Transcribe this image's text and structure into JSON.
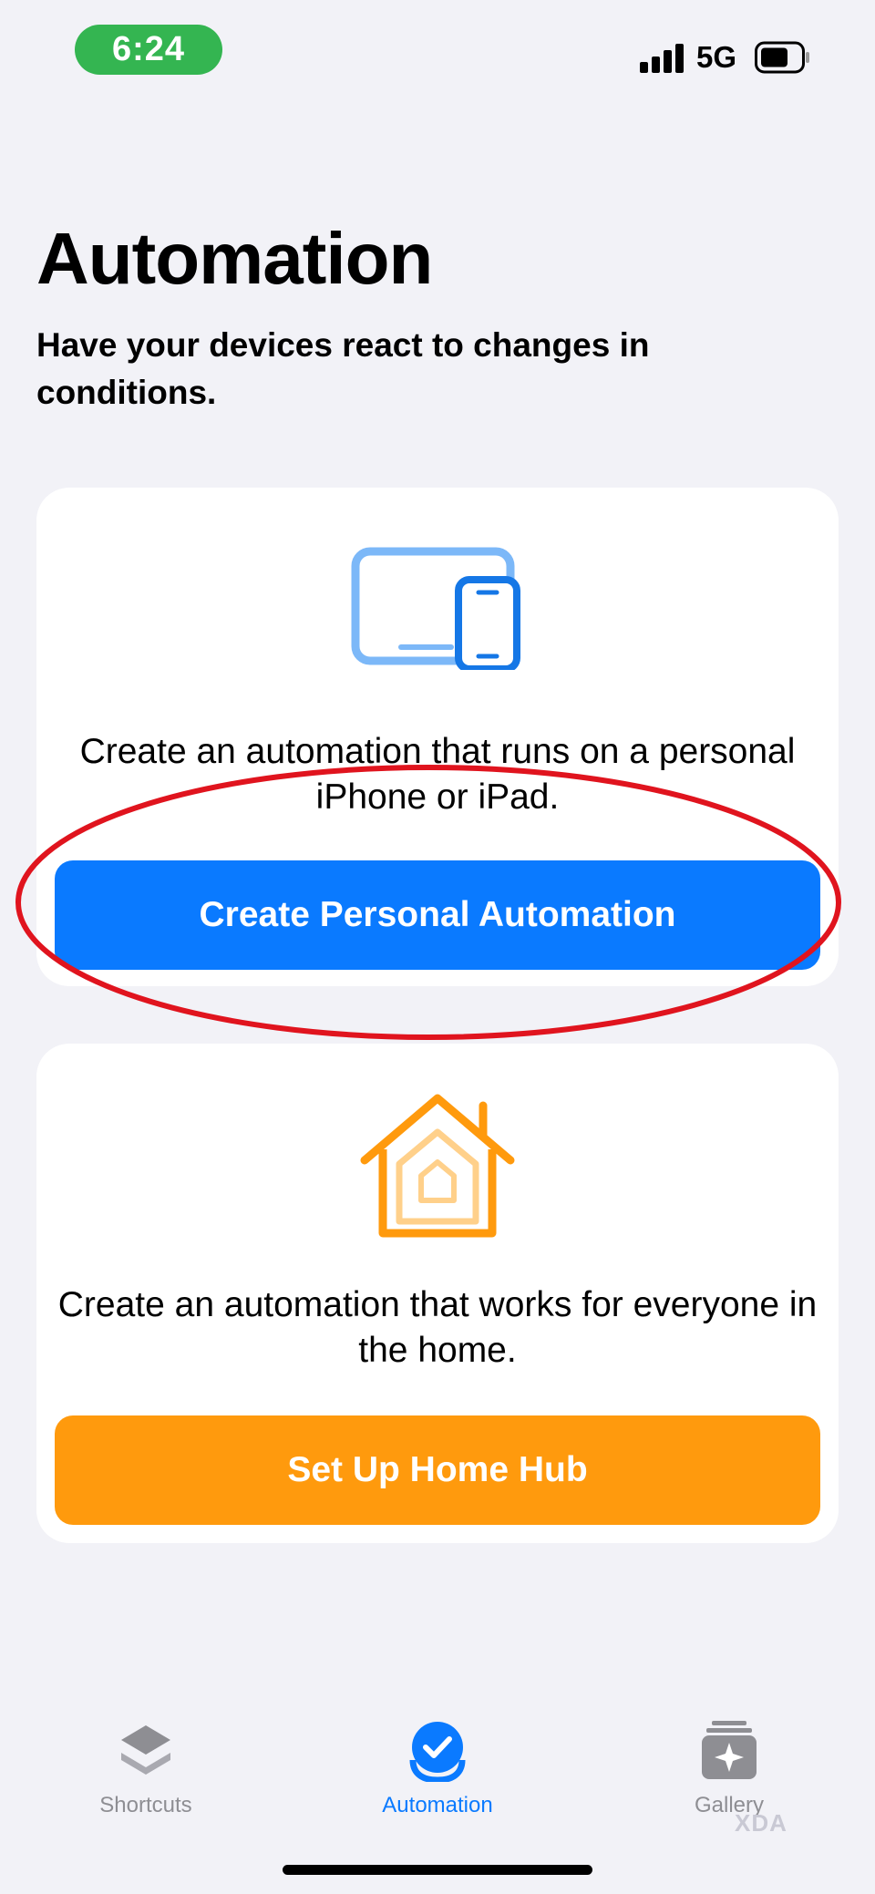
{
  "status_bar": {
    "time": "6:24",
    "network": "5G",
    "time_pill_color": "#34b551"
  },
  "header": {
    "title": "Automation",
    "subtitle": "Have your devices react to changes in conditions."
  },
  "personal_card": {
    "icon": "devices-icon",
    "description": "Create an automation that runs on a personal iPhone or iPad.",
    "button_label": "Create Personal Automation",
    "button_color": "#0a7aff"
  },
  "home_card": {
    "icon": "home-icon",
    "description": "Create an automation that works for everyone in the home.",
    "button_label": "Set Up Home Hub",
    "button_color": "#ff9a0d"
  },
  "annotation": {
    "shape": "ellipse",
    "color": "#e0141e"
  },
  "tab_bar": {
    "active_tab": "Automation",
    "tabs": [
      {
        "label": "Shortcuts",
        "icon": "layers-icon"
      },
      {
        "label": "Automation",
        "icon": "checkmark-circle-icon"
      },
      {
        "label": "Gallery",
        "icon": "sparkle-stack-icon"
      }
    ]
  },
  "watermark": "XDA"
}
